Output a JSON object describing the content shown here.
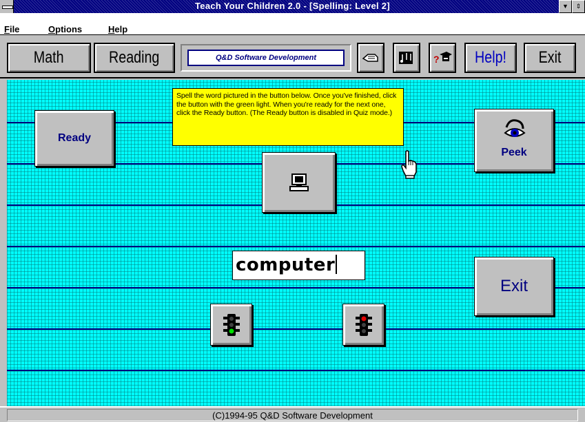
{
  "window": {
    "title": "Teach Your Children 2.0 - [Spelling: Level 2]",
    "minimize_glyph": "▼",
    "restore_glyph": "⇕"
  },
  "menu": {
    "file": {
      "accel": "F",
      "rest": "ile"
    },
    "options": {
      "accel": "O",
      "rest": "ptions"
    },
    "help": {
      "accel": "H",
      "rest": "elp"
    }
  },
  "toolbar": {
    "math_label": "Math",
    "reading_label": "Reading",
    "logo_text": "Q&D Software Development",
    "help_label": "Help!",
    "exit_label": "Exit",
    "icons": [
      "hand-icon",
      "music-note-icon",
      "graduation-cap-icon"
    ]
  },
  "main": {
    "ready_label": "Ready",
    "peek_label": "Peek",
    "exit_label": "Exit",
    "instructions": "Spell the word pictured in the button below. Once you've finished, click the button with the green light. When you're ready for the next one, click the Ready button. (The Ready button is disabled in Quiz mode.)",
    "word_value": "computer",
    "picture_icon": "computer-icon",
    "check_light": "green",
    "wrong_light": "red"
  },
  "status": {
    "copyright": "(C)1994-95 Q&D Software Development"
  },
  "colors": {
    "background": "#00ffff",
    "rule_lines": "#000080",
    "tooltip": "#ffff00",
    "titlebar": "#000080"
  }
}
